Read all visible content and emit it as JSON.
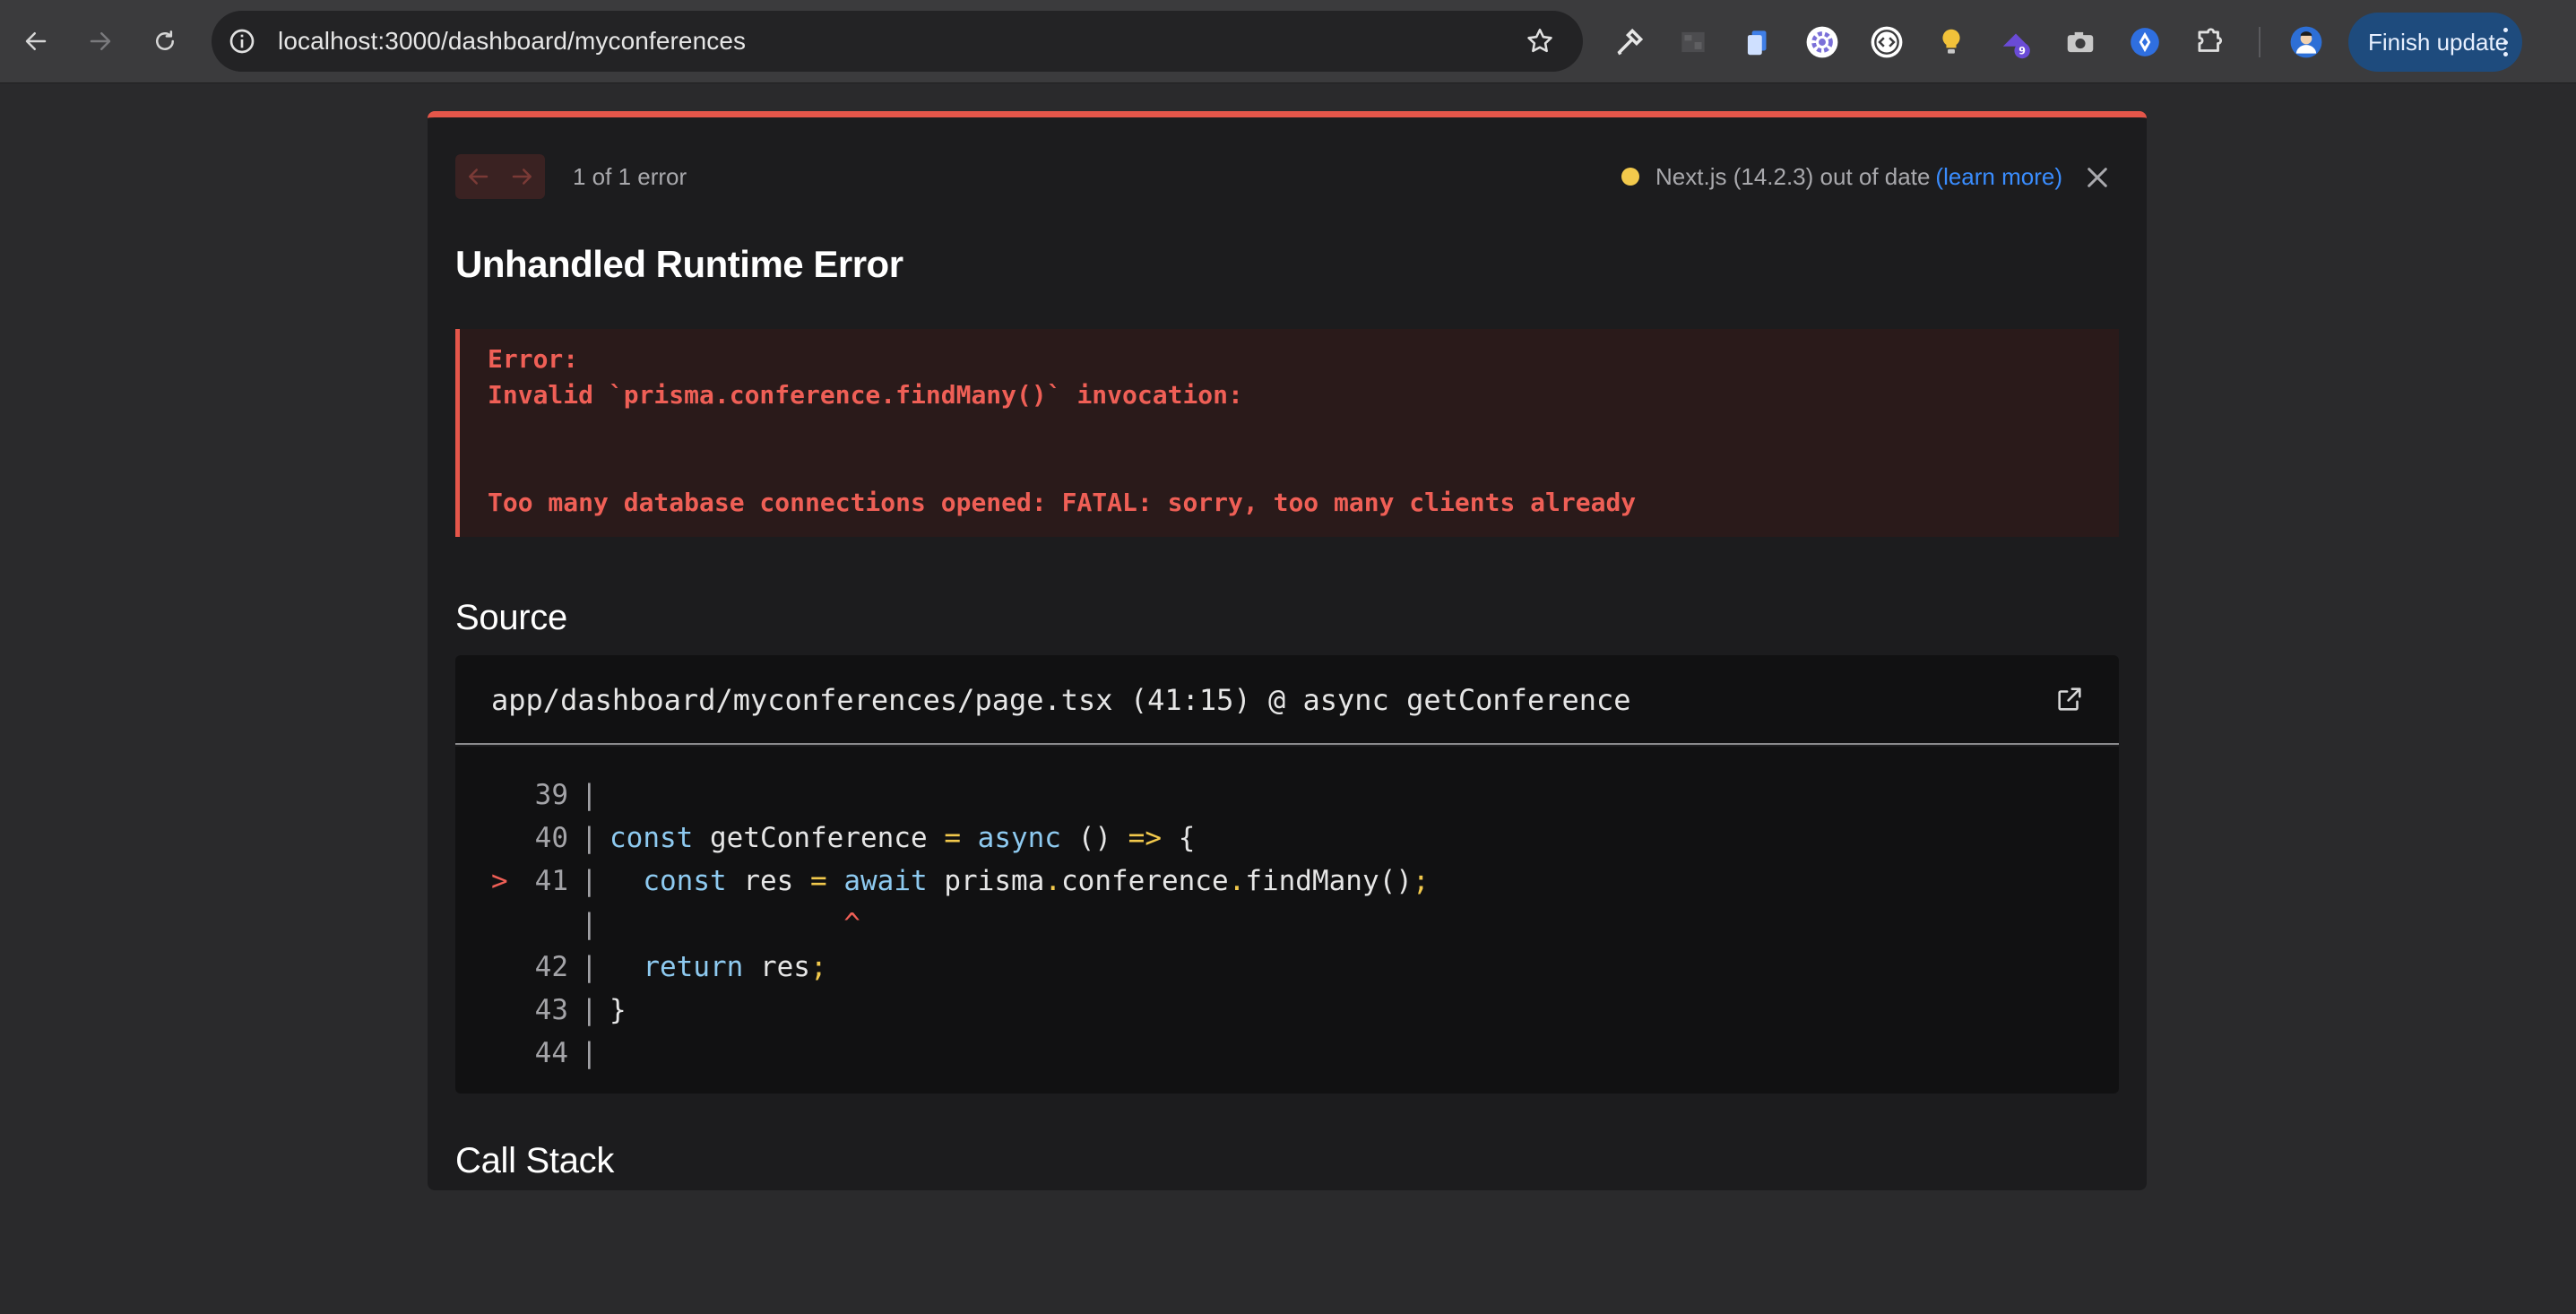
{
  "browser": {
    "url": "localhost:3000/dashboard/myconferences",
    "finish_update_label": "Finish update",
    "extension_badge": "9",
    "icons": [
      "back-arrow-icon",
      "forward-arrow-icon",
      "reload-icon",
      "site-info-icon",
      "bookmark-star-icon",
      "eyedropper-icon",
      "extension-icon",
      "copy-icon",
      "gear-icon",
      "code-icon",
      "lightbulb-icon",
      "hat-icon",
      "camera-icon",
      "diamond-icon",
      "puzzle-icon",
      "profile-avatar",
      "more-vert-icon"
    ]
  },
  "overlay": {
    "error_count": "1 of 1 error",
    "version_text": "Next.js (14.2.3) out of date",
    "learn_more": "(learn more)",
    "title": "Unhandled Runtime Error",
    "error_lines": [
      "Error:",
      "Invalid `prisma.conference.findMany()` invocation:",
      "",
      "",
      "Too many database connections opened: FATAL: sorry, too many clients already"
    ],
    "source_heading": "Source",
    "source_file": "app/dashboard/myconferences/page.tsx (41:15) @ async getConference",
    "call_stack_heading": "Call Stack",
    "colors": {
      "accent_red": "#e5564a",
      "version_dot": "#f2c94c",
      "link_blue": "#3a8dff"
    }
  },
  "code": {
    "lines": [
      {
        "marker": "",
        "num": "39",
        "src": ""
      },
      {
        "marker": "",
        "num": "40",
        "src": "const getConference = async () => {"
      },
      {
        "marker": ">",
        "num": "41",
        "src": "  const res = await prisma.conference.findMany();"
      },
      {
        "marker": "",
        "num": "",
        "src": "              ^"
      },
      {
        "marker": "",
        "num": "42",
        "src": "  return res;"
      },
      {
        "marker": "",
        "num": "43",
        "src": "}"
      },
      {
        "marker": "",
        "num": "44",
        "src": ""
      }
    ]
  }
}
